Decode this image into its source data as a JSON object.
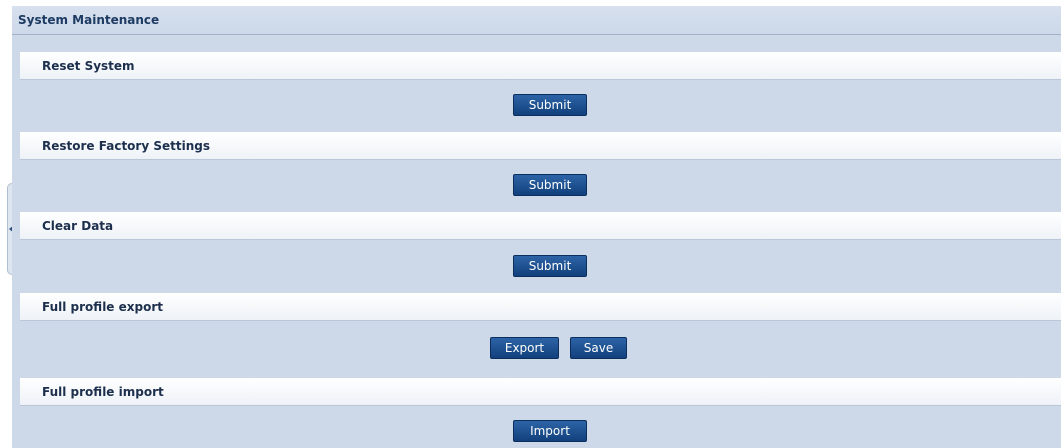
{
  "page": {
    "title": "System Maintenance"
  },
  "sections": [
    {
      "title": "Reset System",
      "buttons": [
        "Submit"
      ]
    },
    {
      "title": "Restore Factory Settings",
      "buttons": [
        "Submit"
      ]
    },
    {
      "title": "Clear Data",
      "buttons": [
        "Submit"
      ]
    },
    {
      "title": "Full profile export",
      "buttons": [
        "Export",
        "Save"
      ]
    },
    {
      "title": "Full profile import",
      "buttons": [
        "Import"
      ]
    }
  ],
  "sidebar_toggle": {
    "icon": "collapse-left-arrow-icon"
  },
  "colors": {
    "panel_background": "#cdd8e9",
    "section_header_background": "#ffffff",
    "button_background": "#1a4c8c",
    "title_text": "#1d3b63"
  }
}
